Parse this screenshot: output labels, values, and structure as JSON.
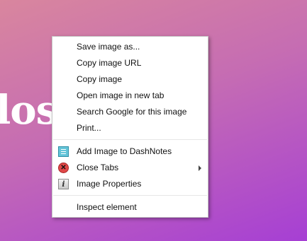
{
  "background": {
    "text_fragment": "los",
    "ghost_fragment": "s",
    "colors": {
      "gradient_start": "#d9869e",
      "gradient_end": "#a63fd4"
    }
  },
  "context_menu": {
    "group_1": [
      "Save image as...",
      "Copy image URL",
      "Copy image",
      "Open image in new tab",
      "Search Google for this image",
      "Print..."
    ],
    "group_2": [
      {
        "label": "Add Image to DashNotes",
        "icon": "dashnotes-icon"
      },
      {
        "label": "Close Tabs",
        "icon": "close-tabs-icon",
        "has_submenu": true
      },
      {
        "label": "Image Properties",
        "icon": "info-icon"
      }
    ],
    "group_3": [
      "Inspect element"
    ]
  }
}
